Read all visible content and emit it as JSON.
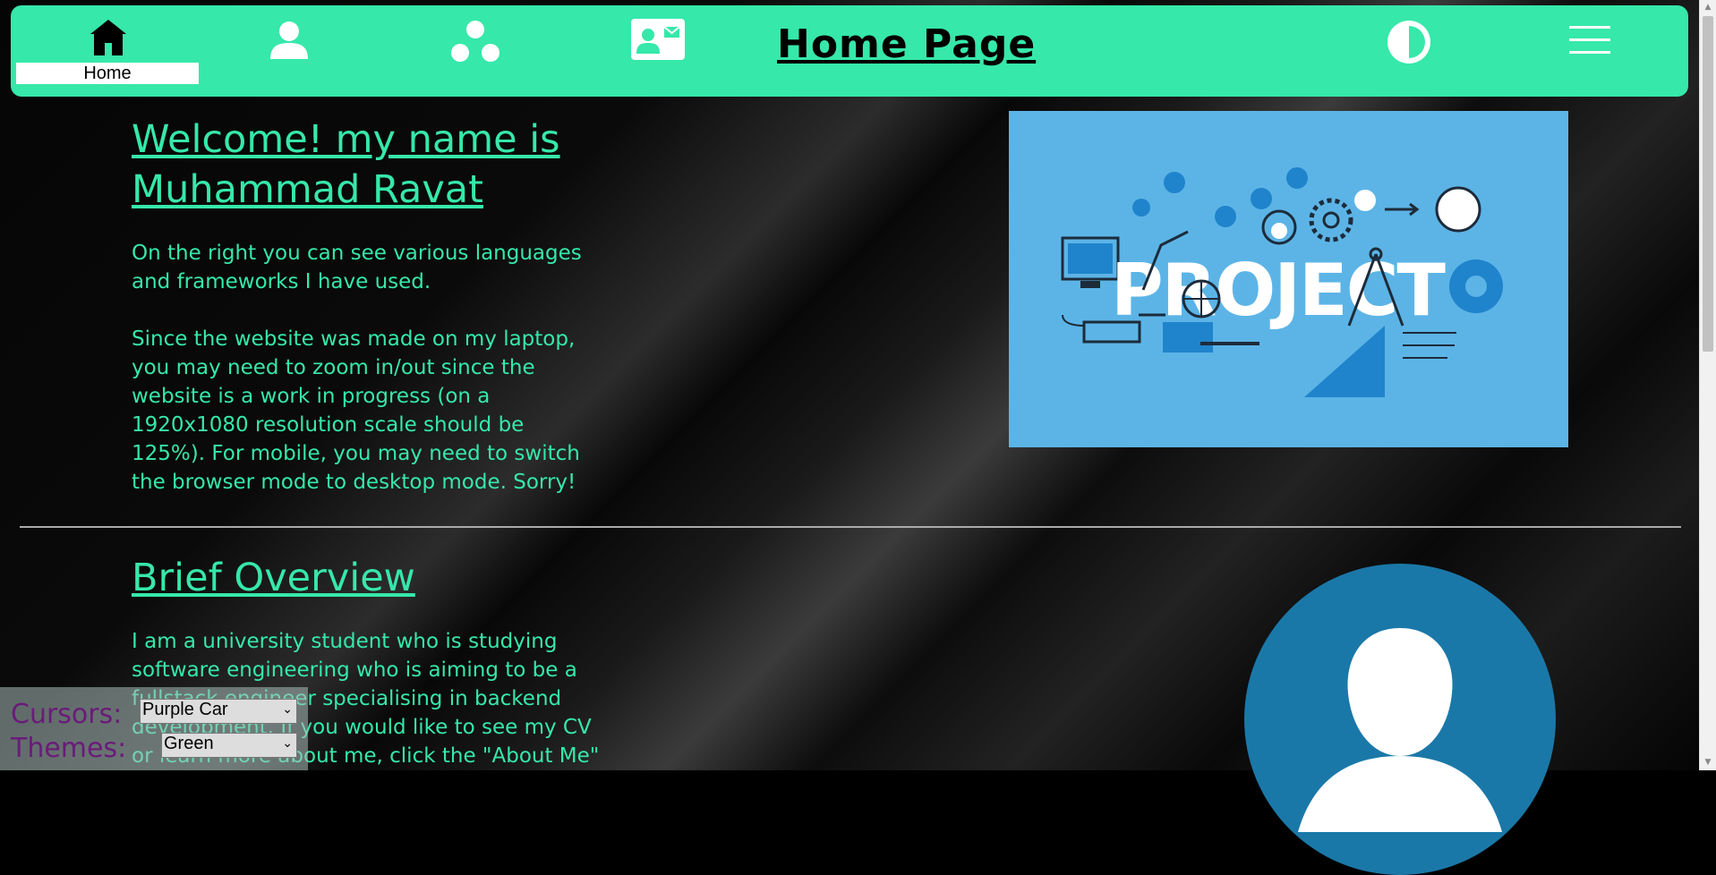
{
  "navbar": {
    "home_label": "Home",
    "page_title": "Home Page",
    "icons": [
      "home-icon",
      "person-icon",
      "three-dots-icon",
      "contact-card-icon",
      "theme-contrast-icon",
      "menu-icon"
    ]
  },
  "welcome": {
    "heading_line1": "Welcome! my name is",
    "heading_line2": "Muhammad Ravat",
    "para1_line1": "On the right you can see various languages",
    "para1_line2": "and frameworks I have used.",
    "para2_line1": "Since the website was made on my laptop,",
    "para2_line2": "you may need to zoom in/out since the",
    "para2_line3": "website is a work in progress (on a",
    "para2_line4": "1920x1080 resolution scale should be",
    "para2_line5": "125%). For mobile, you may need to switch",
    "para2_line6": "the browser mode to desktop mode. Sorry!"
  },
  "project_image": {
    "word": "PROJECT"
  },
  "overview": {
    "heading": "Brief Overview",
    "line1": "I am a university student who is studying",
    "line2": "software engineering who is aiming to be a",
    "line3": "fullstack engineer specialising in backend",
    "line4": "development. If you would like to see my CV",
    "line5": "or learn more about me, click the \"About Me\""
  },
  "controls": {
    "cursors_label": "Cursors:",
    "cursors_value": "Purple Car",
    "themes_label": "Themes:",
    "themes_value": "Green"
  },
  "colors": {
    "accent": "#36e8aa",
    "navbar": "#36e8aa",
    "image_bg": "#5cb4e6",
    "avatar_bg": "#1a78a8",
    "control_label": "#6a1b7a"
  }
}
